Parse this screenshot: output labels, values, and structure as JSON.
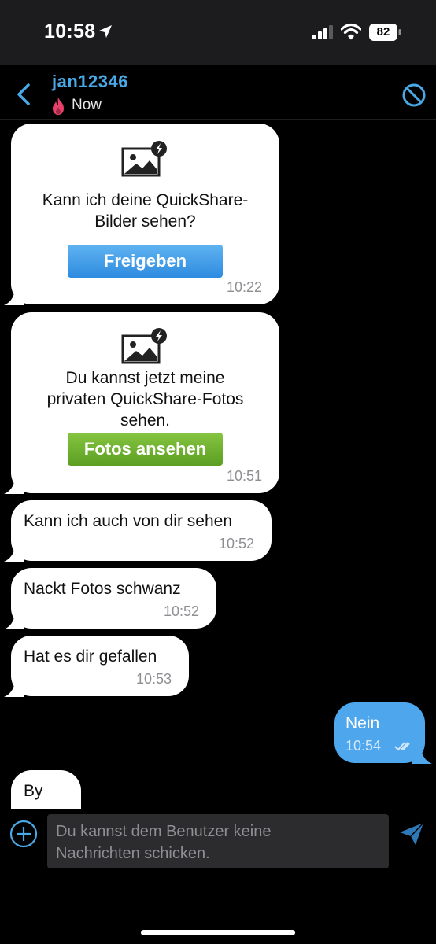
{
  "status_bar": {
    "time": "10:58",
    "battery": "82"
  },
  "header": {
    "contact_name": "jan12346",
    "status": "Now"
  },
  "messages": [
    {
      "type": "quickshare",
      "text_lines": [
        "Kann ich deine QuickShare-",
        "Bilder sehen?"
      ],
      "button": "Freigeben",
      "time": "10:22"
    },
    {
      "type": "quickshare",
      "text_lines": [
        "Du kannst jetzt meine",
        "privaten QuickShare-Fotos",
        "sehen."
      ],
      "button": "Fotos ansehen",
      "time": "10:51"
    },
    {
      "type": "incoming",
      "text": "Kann ich auch von dir sehen",
      "time": "10:52"
    },
    {
      "type": "incoming",
      "text": "Nackt Fotos schwanz",
      "time": "10:52"
    },
    {
      "type": "incoming",
      "text": "Hat es dir gefallen",
      "time": "10:53"
    },
    {
      "type": "outgoing",
      "text": "Nein",
      "time": "10:54"
    },
    {
      "type": "incoming",
      "text": "By"
    }
  ],
  "input": {
    "placeholder_lines": [
      "Du kannst dem Benutzer keine",
      "Nachrichten schicken."
    ]
  },
  "colors": {
    "accent": "#49a9e6",
    "outgoing_bubble": "#4ea6ec",
    "button_blue": "#3a94e4",
    "button_green": "#6cb030"
  },
  "icons": [
    "location-arrow-icon",
    "signal-icon",
    "wifi-icon",
    "battery-icon",
    "back-icon",
    "flame-icon",
    "block-icon",
    "quickshare-image-icon",
    "read-receipt-icon",
    "plus-icon",
    "send-icon"
  ]
}
